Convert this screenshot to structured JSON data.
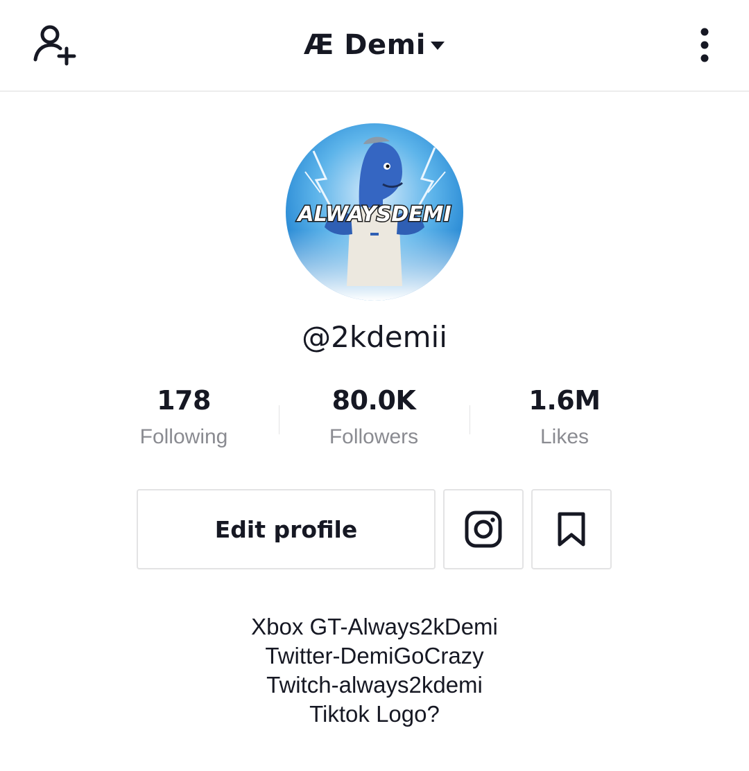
{
  "header": {
    "title": "Æ Demi",
    "left_icon": "add-user-icon",
    "title_icon": "caret-down-icon",
    "right_icon": "more-vertical-icon"
  },
  "profile": {
    "avatar_text": "ALWAYSDEMI",
    "username": "@2kdemii"
  },
  "stats": [
    {
      "value": "178",
      "label": "Following"
    },
    {
      "value": "80.0K",
      "label": "Followers"
    },
    {
      "value": "1.6M",
      "label": "Likes"
    }
  ],
  "actions": {
    "edit_profile_label": "Edit profile",
    "instagram_icon": "instagram-icon",
    "bookmark_icon": "bookmark-icon"
  },
  "bio": [
    "Xbox GT-Always2kDemi",
    "Twitter-DemiGoCrazy",
    "Twitch-always2kdemi",
    "Tiktok Logo?"
  ],
  "colors": {
    "text": "#161823",
    "muted": "#8a8b91",
    "border": "#e3e3e4"
  }
}
